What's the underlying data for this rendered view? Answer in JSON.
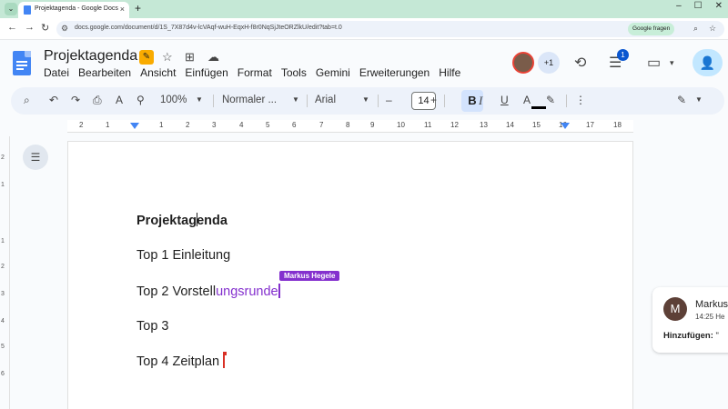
{
  "browser": {
    "tab_title": "Projektagenda - Google Docs",
    "new_tab_label": "+",
    "url": "docs.google.com/document/d/1S_7X87d4v-lcVAqf-wuH-EqxH-f8r0NqSjJteORZlkU/edit?tab=t.0",
    "ask_google_label": "Google fragen"
  },
  "docs": {
    "title": "Projektagenda",
    "menu": [
      "Datei",
      "Bearbeiten",
      "Ansicht",
      "Einfügen",
      "Format",
      "Tools",
      "Gemini",
      "Erweiterungen",
      "Hilfe"
    ],
    "collaborators_more": "+1",
    "notification_count": "1"
  },
  "toolbar": {
    "zoom": "100%",
    "style": "Normaler ...",
    "font": "Arial",
    "font_size": "14"
  },
  "ruler": {
    "numbers": [
      "2",
      "1",
      "1",
      "2",
      "3",
      "4",
      "5",
      "6",
      "7",
      "8",
      "9",
      "10",
      "11",
      "12",
      "13",
      "14",
      "15",
      "16",
      "17",
      "18"
    ]
  },
  "vertical_ruler": {
    "numbers": [
      "2",
      "1",
      "1",
      "2",
      "3",
      "4",
      "5",
      "6"
    ]
  },
  "document": {
    "heading_part1": "Projektag",
    "heading_part2": "enda",
    "line1": "Top 1 Einleitung",
    "line2_plain": "Top 2 Vorstell",
    "line2_suggested": "ungsrunde",
    "line3": "Top 3",
    "line4": "Top 4 Zeitplan",
    "collaborator_flag": "Markus Hegele"
  },
  "comment": {
    "avatar_letter": "M",
    "author": "Markus",
    "time": "14:25 He",
    "action_label": "Hinzufügen:",
    "action_value": "\""
  },
  "colors": {
    "suggestion": "#8430ce",
    "accent": "#0b57d0",
    "tabbar": "#c5e8d6"
  }
}
